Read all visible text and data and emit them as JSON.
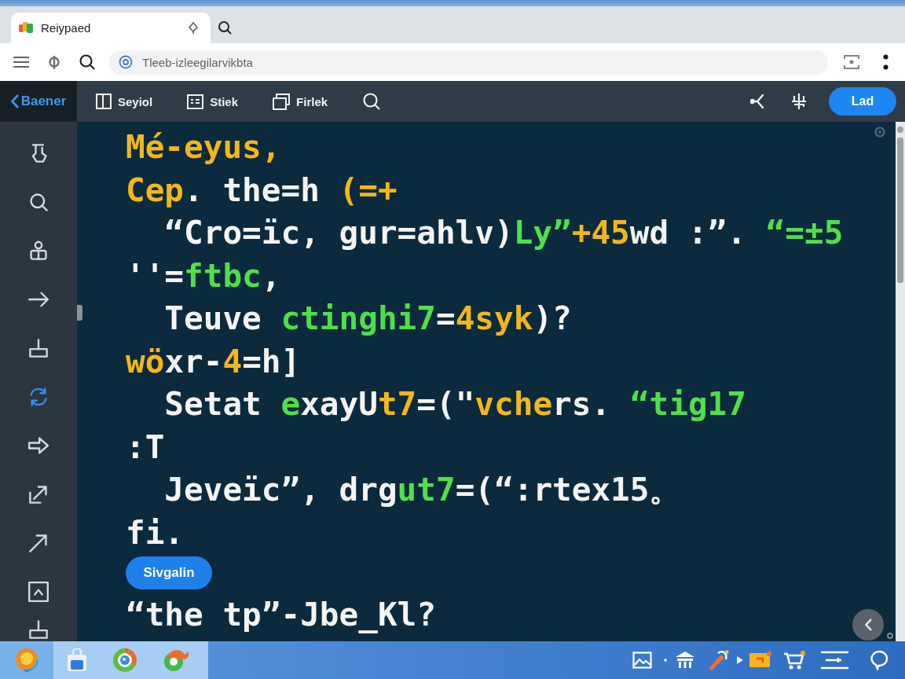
{
  "browser": {
    "tab": {
      "title": "Reiypaed"
    },
    "address_bar": {
      "value": "Tleeb-izleegilarvikbta"
    }
  },
  "toolbar": {
    "back_label": "Baener",
    "items": [
      {
        "label": "Seyiol"
      },
      {
        "label": "Stiek"
      },
      {
        "label": "Firlek"
      }
    ],
    "primary_button": "Lad"
  },
  "sidebar": {
    "items": [
      {
        "selected": false
      },
      {
        "selected": false
      },
      {
        "selected": false
      },
      {
        "selected": false
      },
      {
        "selected": false
      },
      {
        "selected": true
      },
      {
        "selected": false
      },
      {
        "selected": false
      },
      {
        "selected": false
      },
      {
        "selected": false
      },
      {
        "selected": false
      }
    ]
  },
  "editor": {
    "content": [
      {
        "kind": "code",
        "segments": [
          {
            "text": "Mé-eyus,",
            "color": "#f4b719"
          }
        ]
      },
      {
        "kind": "code",
        "segments": [
          {
            "text": "Cep",
            "color": "#f4b719"
          },
          {
            "text": ". the=h ",
            "color": "#f4f4f4"
          },
          {
            "text": "(=+",
            "color": "#f4b719"
          }
        ],
        "children": [
          {
            "kind": "code",
            "segments": [
              {
                "text": "“Cro=ïc, gur=ahlv)",
                "color": "#f4f4f4"
              },
              {
                "text": "Ly”",
                "color": "#4fe04a"
              },
              {
                "text": "+45",
                "color": "#f4b719"
              },
              {
                "text": "wd :”. ",
                "color": "#f4f4f4"
              },
              {
                "text": "“=±5",
                "color": "#4fe04a"
              }
            ]
          }
        ]
      },
      {
        "kind": "code",
        "segments": [
          {
            "text": "''=",
            "color": "#f4f4f4"
          },
          {
            "text": "ftbc",
            "color": "#4fe04a"
          },
          {
            "text": ",",
            "color": "#f4f4f4"
          }
        ],
        "children": [
          {
            "kind": "code",
            "segments": [
              {
                "text": "Teuve ",
                "color": "#f4f4f4"
              },
              {
                "text": "ctinghi7",
                "color": "#4fe04a"
              },
              {
                "text": "=",
                "color": "#f4f4f4"
              },
              {
                "text": "4syk",
                "color": "#f4b719"
              },
              {
                "text": ")?",
                "color": "#f4f4f4"
              }
            ]
          }
        ]
      },
      {
        "kind": "code",
        "segments": [
          {
            "text": "wö",
            "color": "#f4b719"
          },
          {
            "text": "xr-",
            "color": "#f4f4f4"
          },
          {
            "text": "4",
            "color": "#f4b719"
          },
          {
            "text": "=h]",
            "color": "#f4f4f4"
          }
        ],
        "children": [
          {
            "kind": "code",
            "segments": [
              {
                "text": "Setat ",
                "color": "#f4f4f4"
              },
              {
                "text": "e",
                "color": "#4fe04a"
              },
              {
                "text": "xayU",
                "color": "#f4f4f4"
              },
              {
                "text": "t7",
                "color": "#f4b719"
              },
              {
                "text": "=(\"",
                "color": "#f4f4f4"
              },
              {
                "text": "vche",
                "color": "#f4b719"
              },
              {
                "text": "rs. ",
                "color": "#f4f4f4"
              },
              {
                "text": "“tig17",
                "color": "#4fe04a"
              }
            ]
          }
        ]
      },
      {
        "kind": "code",
        "segments": [
          {
            "text": ":T",
            "color": "#f4f4f4"
          }
        ],
        "children": [
          {
            "kind": "code",
            "segments": [
              {
                "text": "Jeveïc”, drg",
                "color": "#f4f4f4"
              },
              {
                "text": "ut7",
                "color": "#4fe04a"
              },
              {
                "text": "=(“:rtex15。",
                "color": "#f4f4f4"
              }
            ]
          }
        ]
      },
      {
        "kind": "code",
        "segments": [
          {
            "text": "fi.",
            "color": "#f4f4f4"
          }
        ]
      },
      {
        "kind": "button",
        "label": "Sivgalin"
      },
      {
        "kind": "code",
        "segments": [
          {
            "text": "“the tp”-Jbe_Kl?",
            "color": "#f4f4f4"
          }
        ]
      }
    ]
  }
}
